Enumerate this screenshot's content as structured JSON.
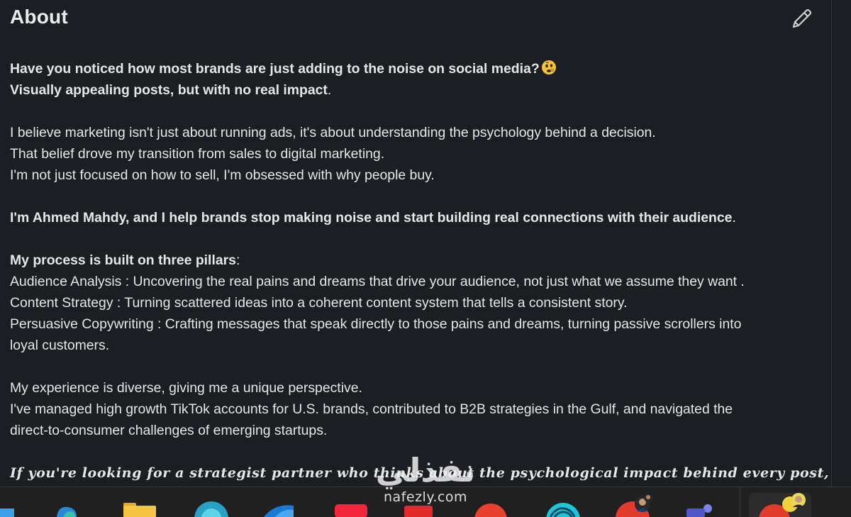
{
  "section": {
    "title": "About",
    "edit_icon": "pencil-icon"
  },
  "about": {
    "p1_l1": "Have you noticed how most brands are just adding to the noise on social media?",
    "p1_emoji": "thinking-face-emoji",
    "p1_l2": "Visually appealing posts, but with no real impact",
    "p1_l2_end": ".",
    "p2_l1": "I believe marketing isn't just about running ads, it's about understanding the psychology behind a decision.",
    "p2_l2": "That belief drove my transition from sales to digital marketing.",
    "p2_l3": "I'm not just focused on how to sell, I'm obsessed with why people buy.",
    "p3_bold": "I'm Ahmed Mahdy, and I help brands stop making noise and start building real connections with their audience",
    "p3_end": ".",
    "p4_head_bold": "My process is built on three pillars",
    "p4_head_end": ":",
    "p4_l1": "Audience Analysis : Uncovering the real pains and dreams that drive your audience, not just what we assume they want .",
    "p4_l2": "Content Strategy : Turning scattered ideas into a coherent content system that tells a consistent story.",
    "p4_l3a": "Persuasive Copywriting : Crafting messages that speak directly to those pains and dreams, turning passive scrollers into",
    "p4_l3b": "loyal customers.",
    "p5_l1": "My experience is diverse, giving me a unique perspective.",
    "p5_l2a": "I've managed high growth TikTok accounts for U.S. brands, contributed to B2B strategies in the Gulf, and navigated the",
    "p5_l2b": "direct-to-consumer challenges of emerging startups.",
    "p6_l1": "If you're looking for a strategist partner who thinks about the psychological impact behind every post,"
  },
  "watermark": {
    "arabic": "نفذلي",
    "latin": "nafezly.com"
  },
  "taskbar": {
    "icons": [
      "windows-start-icon",
      "edge-icon",
      "file-explorer-icon",
      "chrome-icon",
      "outlook-icon",
      "youtube-icon",
      "app-red-icon",
      "cursor-app-icon",
      "chrome-profile-icon",
      "teams-icon",
      "chrome-profile-active-icon"
    ]
  },
  "colors": {
    "background": "#1b1f23",
    "text": "#e6e6e6",
    "taskbar": "#202020"
  }
}
